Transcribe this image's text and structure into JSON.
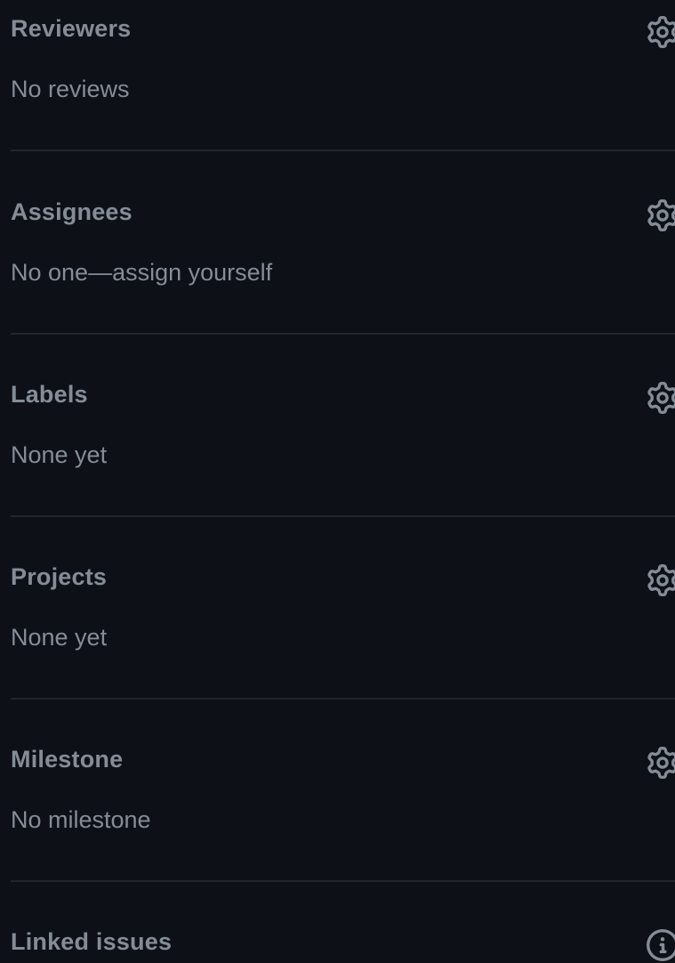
{
  "sections": [
    {
      "title": "Reviewers",
      "value": "No reviews",
      "icon": "gear-icon"
    },
    {
      "title": "Assignees",
      "value": "No one—assign yourself",
      "icon": "gear-icon"
    },
    {
      "title": "Labels",
      "value": "None yet",
      "icon": "gear-icon"
    },
    {
      "title": "Projects",
      "value": "None yet",
      "icon": "gear-icon"
    },
    {
      "title": "Milestone",
      "value": "No milestone",
      "icon": "gear-icon"
    },
    {
      "title": "Linked issues",
      "icon": "info-icon"
    }
  ],
  "colors": {
    "background": "#0d1117",
    "text": "#848d97",
    "divider": "#21262d"
  }
}
